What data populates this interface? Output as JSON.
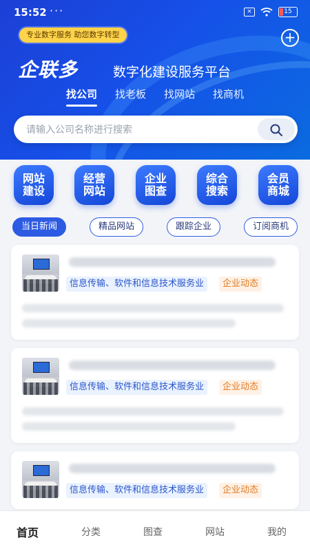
{
  "status_bar": {
    "time": "15:52",
    "dots": "···",
    "battery": "15"
  },
  "header": {
    "promo_badge": "专业数字服务 助您数字转型",
    "logo_text": "企联多",
    "slogan": "数字化建设服务平台",
    "tabs": [
      "找公司",
      "找老板",
      "找网站",
      "找商机"
    ],
    "active_tab": 0
  },
  "search": {
    "placeholder": "请输入公司名称进行搜索"
  },
  "grid_items": [
    {
      "label": "网站\n建设",
      "icon": "website-build-icon"
    },
    {
      "label": "经营\n网站",
      "icon": "operate-site-icon"
    },
    {
      "label": "企业\n图查",
      "icon": "enterprise-graph-icon"
    },
    {
      "label": "综合\n搜索",
      "icon": "search-all-icon"
    },
    {
      "label": "会员\n商城",
      "icon": "member-mall-icon"
    }
  ],
  "chips": [
    "当日新闻",
    "精品网站",
    "跟踪企业",
    "订阅商机"
  ],
  "cards": [
    {
      "industry_tag": "信息传输、软件和信息技术服务业",
      "event_tag": "企业动态"
    },
    {
      "industry_tag": "信息传输、软件和信息技术服务业",
      "event_tag": "企业动态"
    },
    {
      "industry_tag": "信息传输、软件和信息技术服务业",
      "event_tag": "企业动态"
    }
  ],
  "bottom_nav": [
    "首页",
    "分类",
    "图查",
    "网站",
    "我的"
  ],
  "colors": {
    "primary": "#1c4fe0",
    "promo": "#ffd34a",
    "tag_blue": "#2a56c8",
    "tag_orange": "#e07b22"
  }
}
